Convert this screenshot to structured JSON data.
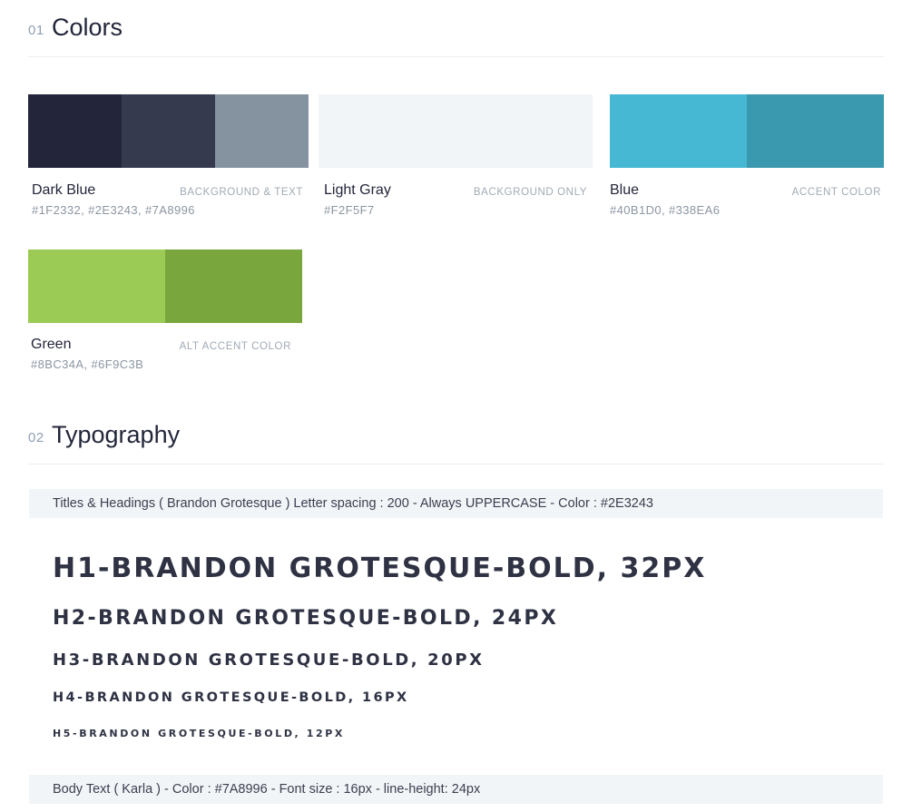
{
  "colors_section": {
    "number": "01",
    "title": "Colors"
  },
  "swatches": [
    {
      "name": "Dark Blue",
      "usage": "BACKGROUND & TEXT",
      "hex_label": "#1F2332, #2E3243, #7A8996",
      "colors": [
        "#23263A",
        "#363A4E",
        "#8593A1"
      ]
    },
    {
      "name": "Light Gray",
      "usage": "BACKGROUND ONLY",
      "hex_label": "#F2F5F7",
      "colors": [
        "#F2F5F7"
      ]
    },
    {
      "name": "Blue",
      "usage": "ACCENT COLOR",
      "hex_label": "#40B1D0, #338EA6",
      "colors": [
        "#47B8D4",
        "#3A99AE"
      ]
    },
    {
      "name": "Green",
      "usage": "ALT ACCENT COLOR",
      "hex_label": "#8BC34A, #6F9C3B",
      "colors": [
        "#9BCB55",
        "#7AA63E"
      ]
    }
  ],
  "typography_section": {
    "number": "02",
    "title": "Typography"
  },
  "titles_note": "Titles & Headings ( Brandon Grotesque ) Letter spacing : 200 - Always UPPERCASE - Color : #2E3243",
  "headings": [
    "H1-BRANDON GROTESQUE-BOLD, 32PX",
    "H2-BRANDON GROTESQUE-BOLD, 24PX",
    "H3-BRANDON GROTESQUE-BOLD, 20PX",
    "H4-BRANDON GROTESQUE-BOLD, 16PX",
    "H5-BRANDON GROTESQUE-BOLD, 12PX"
  ],
  "body_note": "Body Text ( Karla ) - Color : #7A8996  - Font size : 16px - line-height: 24px"
}
